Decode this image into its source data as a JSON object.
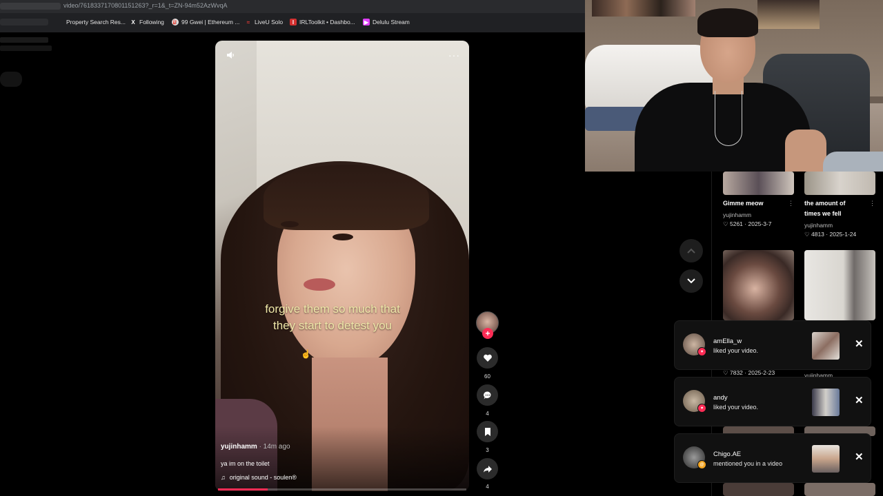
{
  "browser": {
    "url": "video/761833717080115126​3?_r=1&_t=ZN-94m52AzWvqA",
    "bookmarks": [
      {
        "label": "Property Search Res...",
        "icon": "page-icon",
        "color": "#3c4043"
      },
      {
        "label": "Following",
        "icon": "x-logo-icon",
        "color": "#000000"
      },
      {
        "label": "99 Gwei | Ethereum ...",
        "icon": "gas-icon",
        "color": "#5f6368"
      },
      {
        "label": "LiveU Solo",
        "icon": "liveu-icon",
        "color": "#e53935"
      },
      {
        "label": "IRLToolkit • Dashbo...",
        "icon": "irl-icon",
        "color": "#d32f2f"
      },
      {
        "label": "Delulu Stream",
        "icon": "stream-icon",
        "color": "#e040fb"
      }
    ]
  },
  "video": {
    "caption_line1": "forgive them so much that",
    "caption_line2": "they start to detest you",
    "author": "yujinhamm",
    "posted": "· 14m ago",
    "description": "ya im on the toilet",
    "sound": "original sound - soulen®",
    "sound_icon": "music-note-icon",
    "progress_fraction": 0.2
  },
  "actions": {
    "likes": "60",
    "comments": "4",
    "saves": "3",
    "shares": "4",
    "accent_color": "#fe2c55"
  },
  "grid": [
    {
      "title": "Gimme meow",
      "user": "yujinhamm",
      "likes": "5261",
      "date": "2025-3-7"
    },
    {
      "title_line1": "the amount of",
      "title_line2": "times we fell",
      "user": "yujinhamm",
      "likes": "4813",
      "date": "2025-1-24"
    },
    {
      "likes": "7832",
      "date": "2025-2-23",
      "user": "yujinhamm"
    }
  ],
  "notifications": [
    {
      "user": "amElla_w",
      "action": "liked your video.",
      "badge_color": "#fe2c55"
    },
    {
      "user": "andy",
      "action": "liked your video.",
      "badge_color": "#fe2c55"
    },
    {
      "user": "Chigo.AE",
      "action": "mentioned you in a video",
      "badge_color": "#f5a623"
    }
  ]
}
